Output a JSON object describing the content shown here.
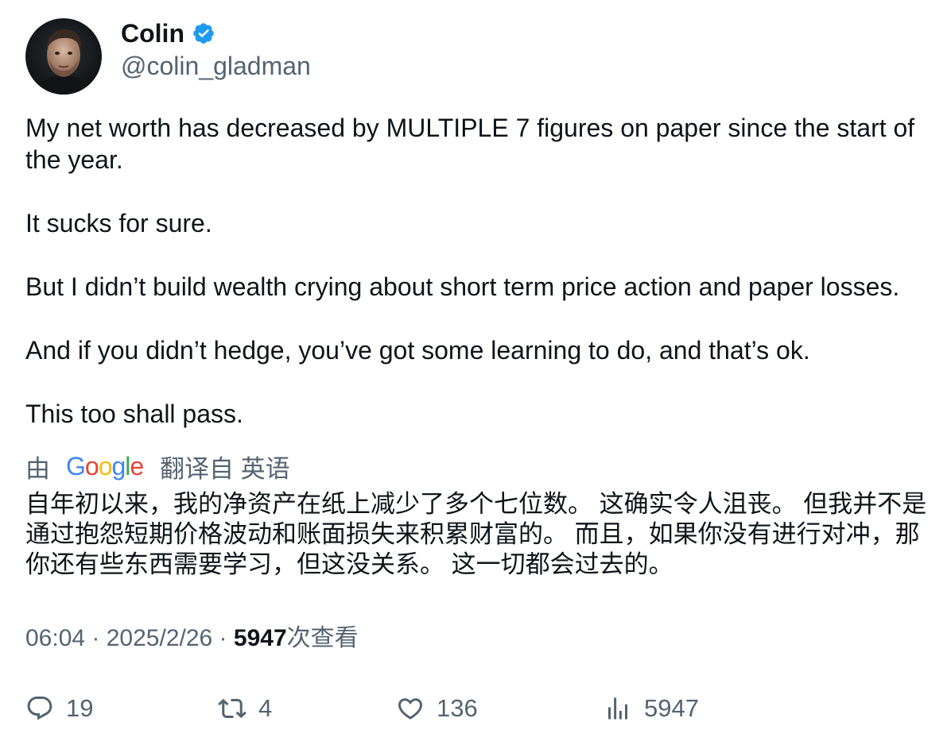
{
  "author": {
    "display_name": "Colin",
    "handle": "@colin_gladman",
    "verified": true,
    "verified_color": "#1d9bf0"
  },
  "tweet": {
    "paragraphs": [
      "My net worth has decreased by MULTIPLE 7 figures on paper since the start of the year.",
      "It sucks for sure.",
      "But I didn’t build wealth crying about short term price action and paper losses.",
      "And if you didn’t hedge, you’ve got some learning to do, and that’s ok.",
      "This too shall pass."
    ]
  },
  "translation": {
    "prefix": "由",
    "provider": "Google",
    "suffix": "翻译自 英语",
    "text": "自年初以来，我的净资产在纸上减少了多个七位数。 这确实令人沮丧。 但我并不是通过抱怨短期价格波动和账面损失来积累财富的。 而且，如果你没有进行对冲，那你还有些东西需要学习，但这没关系。 这一切都会过去的。"
  },
  "meta": {
    "time": "06:04",
    "separator": " · ",
    "date": "2025/2/26",
    "views": "5947",
    "views_label": "次查看"
  },
  "actions": {
    "replies": "19",
    "retweets": "4",
    "likes": "136",
    "views": "5947",
    "icon_color": "#536471"
  }
}
